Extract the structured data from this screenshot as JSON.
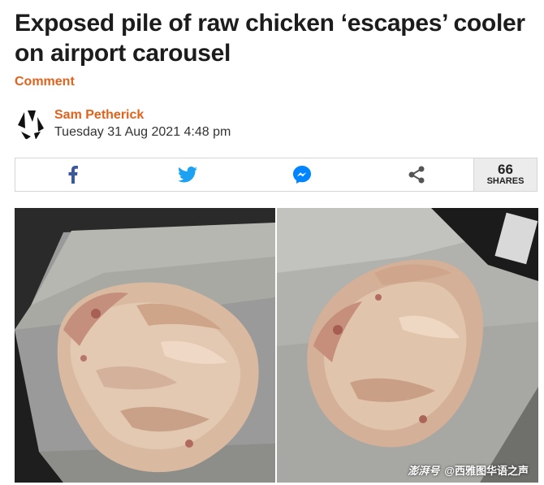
{
  "article": {
    "headline": "Exposed pile of raw chicken ‘escapes’ cooler on airport carousel",
    "category": "Comment",
    "author": "Sam Petherick",
    "date": "Tuesday 31 Aug 2021 4:48 pm"
  },
  "share_bar": {
    "buttons": [
      {
        "icon": "facebook-icon",
        "color": "#3b5998"
      },
      {
        "icon": "twitter-icon",
        "color": "#1da1f2"
      },
      {
        "icon": "messenger-icon",
        "color": "#0084ff"
      },
      {
        "icon": "share-icon",
        "color": "#555555"
      }
    ],
    "count": "66",
    "count_label": "SHARES"
  },
  "photos": {
    "count": 2,
    "subject": "raw-chicken-on-carousel",
    "watermark_logo": "澎湃号",
    "watermark_text": "@西雅图华语之声"
  },
  "colors": {
    "accent": "#e2621b",
    "headline": "#1c1c1c"
  }
}
